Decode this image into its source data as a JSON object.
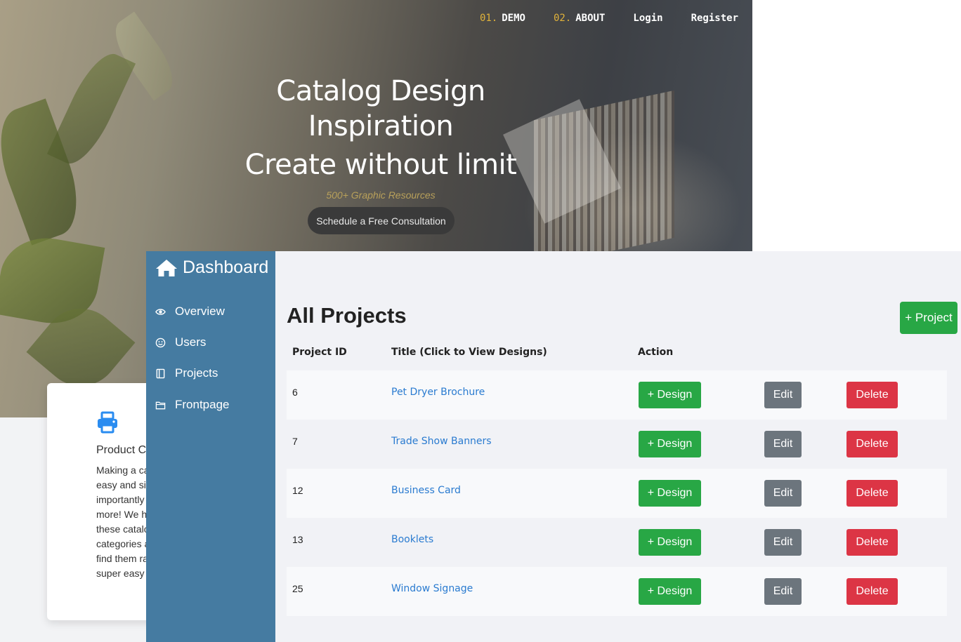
{
  "landing": {
    "nav": [
      {
        "num": "01.",
        "label": "DEMO"
      },
      {
        "num": "02.",
        "label": "ABOUT"
      },
      {
        "num": "",
        "label": "Login"
      },
      {
        "num": "",
        "label": "Register"
      }
    ],
    "title_line1": "Catalog Design",
    "title_line2": "Inspiration",
    "subtitle": "Create without limit",
    "tagline": "500+ Graphic Resources",
    "cta": "Schedule a Free Consultation",
    "card": {
      "icon": "printer-icon",
      "title": "Product C",
      "text_lines": [
        "Making a ca",
        "easy and si",
        "importantly",
        "more! We h",
        "these catalo",
        "categories a",
        "find them ra",
        "super easy"
      ]
    }
  },
  "dashboard": {
    "brand": "Dashboard",
    "sidebar": [
      {
        "icon": "eye-icon",
        "label": "Overview"
      },
      {
        "icon": "smiley-icon",
        "label": "Users"
      },
      {
        "icon": "book-icon",
        "label": "Projects"
      },
      {
        "icon": "folder-icon",
        "label": "Frontpage"
      }
    ],
    "page_title": "All Projects",
    "add_button": "+ Project",
    "columns": [
      "Project ID",
      "Title (Click to View Designs)",
      "Action"
    ],
    "rows": [
      {
        "id": "6",
        "title": "Pet Dryer Brochure"
      },
      {
        "id": "7",
        "title": "Trade Show Banners"
      },
      {
        "id": "12",
        "title": "Business Card"
      },
      {
        "id": "13",
        "title": "Booklets"
      },
      {
        "id": "25",
        "title": "Window Signage"
      }
    ],
    "row_buttons": {
      "design": "+ Design",
      "edit": "Edit",
      "delete": "Delete"
    },
    "colors": {
      "sidebar": "#457ba1",
      "success": "#28a745",
      "secondary": "#6c757d",
      "danger": "#dc3545",
      "link": "#2a7bd0"
    }
  }
}
